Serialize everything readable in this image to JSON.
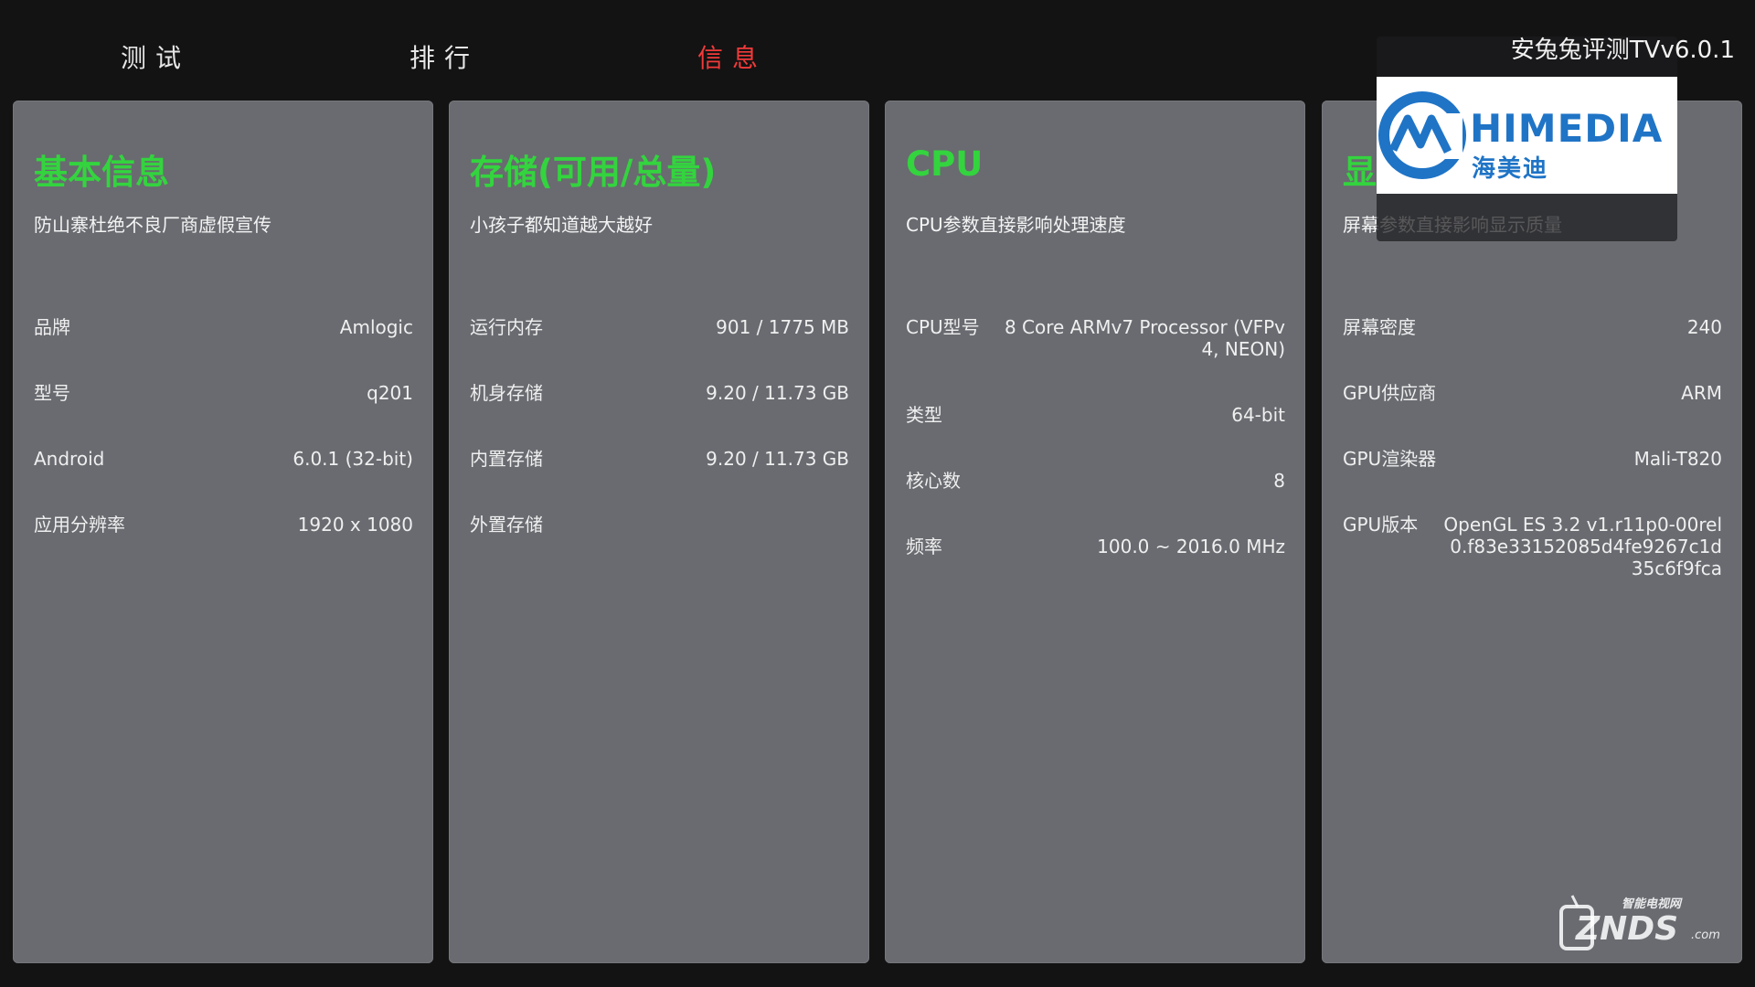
{
  "tabs": [
    {
      "label": "测试",
      "active": false
    },
    {
      "label": "排行",
      "active": false
    },
    {
      "label": "信息",
      "active": true
    }
  ],
  "version": "安兔兔评测TVv6.0.1",
  "colors": {
    "background": "#131313",
    "panel": "#696b70",
    "title_green": "#33d43e",
    "tab_active": "#f23a3a",
    "logo_blue": "#1f74c6"
  },
  "panels": [
    {
      "title": "基本信息",
      "subtitle": "防山寨杜绝不良厂商虚假宣传",
      "rows": [
        {
          "label": "品牌",
          "value": "Amlogic"
        },
        {
          "label": "型号",
          "value": "q201"
        },
        {
          "label": "Android",
          "value": "6.0.1 (32-bit)"
        },
        {
          "label": "应用分辨率",
          "value": "1920 x 1080"
        }
      ]
    },
    {
      "title": "存储(可用/总量)",
      "subtitle": "小孩子都知道越大越好",
      "rows": [
        {
          "label": "运行内存",
          "value": "901 / 1775 MB"
        },
        {
          "label": "机身存储",
          "value": "9.20 / 11.73 GB"
        },
        {
          "label": "内置存储",
          "value": "9.20 / 11.73 GB"
        },
        {
          "label": "外置存储",
          "value": ""
        }
      ]
    },
    {
      "title": "CPU",
      "subtitle": "CPU参数直接影响处理速度",
      "rows": [
        {
          "label": "CPU型号",
          "value": "8 Core ARMv7 Processor (VFPv4, NEON)"
        },
        {
          "label": "类型",
          "value": "64-bit"
        },
        {
          "label": "核心数",
          "value": "8"
        },
        {
          "label": "频率",
          "value": "100.0 ~ 2016.0 MHz"
        }
      ]
    },
    {
      "title": "显",
      "subtitle": "屏幕参数直接影响显示质量",
      "rows": [
        {
          "label": "屏幕密度",
          "value": "240"
        },
        {
          "label": "GPU供应商",
          "value": "ARM"
        },
        {
          "label": "GPU渲染器",
          "value": "Mali-T820"
        },
        {
          "label": "GPU版本",
          "value": "OpenGL ES 3.2 v1.r11p0-00rel0.f83e33152085d4fe9267c1d35c6f9fca"
        }
      ]
    }
  ],
  "overlay": {
    "brand": "HIMEDIA",
    "brand_cn": "海美迪"
  },
  "watermark": {
    "text": "ZNDS",
    "small": "智能电视网",
    "suffix": ".com"
  }
}
